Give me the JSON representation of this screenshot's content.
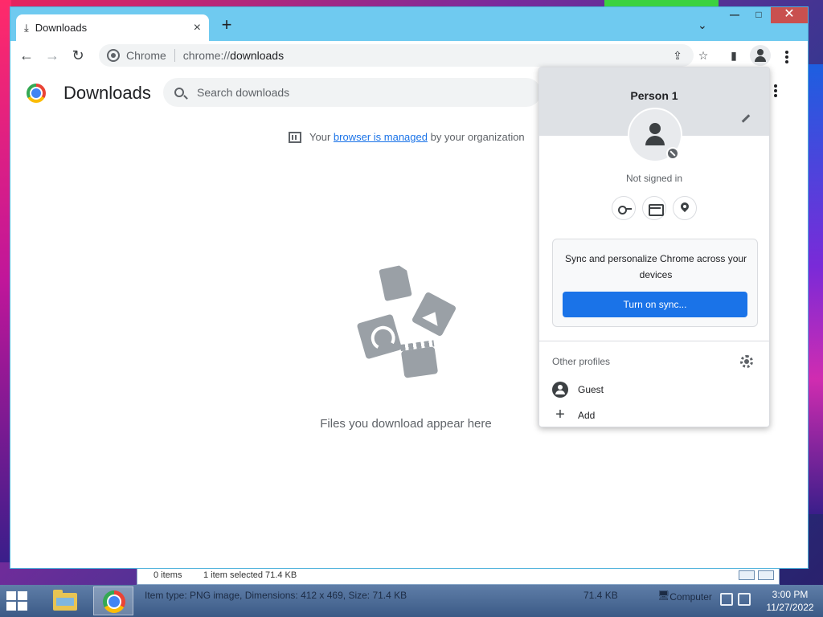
{
  "desktop": {
    "explorer_strip": {
      "items_count": "0 items",
      "selected": "1 item selected  71.4 KB"
    }
  },
  "chrome": {
    "tab": {
      "title": "Downloads",
      "icon": "download-icon"
    },
    "new_tab": "+",
    "tab_search": "⌄",
    "window_controls": {
      "minimize": "—",
      "maximize": "□",
      "close": "✕"
    },
    "toolbar": {
      "back": "←",
      "forward": "→",
      "reload": "↻",
      "omnibox": {
        "scheme_label": "Chrome",
        "url_prefix": "chrome://",
        "url_host": "downloads"
      },
      "share": "⇪",
      "bookmark": "☆",
      "side_panel": "▮"
    }
  },
  "page": {
    "title": "Downloads",
    "search_placeholder": "Search downloads",
    "managed": {
      "prefix": "Your",
      "link": "browser is managed",
      "suffix": "by your organization"
    },
    "empty_text": "Files you download appear here"
  },
  "profile_popup": {
    "name": "Person 1",
    "status": "Not signed in",
    "quick_icons": [
      "key-icon",
      "credit-card-icon",
      "location-pin-icon"
    ],
    "sync_text": "Sync and personalize Chrome across your devices",
    "sync_button": "Turn on sync...",
    "other_profiles_label": "Other profiles",
    "profiles": [
      {
        "label": "Guest",
        "icon": "guest-icon"
      },
      {
        "label": "Add",
        "icon": "add-icon"
      }
    ]
  },
  "taskbar": {
    "status_text": "Item type: PNG image, Dimensions: 412 x 469, Size: 71.4 KB",
    "size": "71.4 KB",
    "location": "Computer",
    "time": "3:00 PM",
    "date": "11/27/2022"
  }
}
